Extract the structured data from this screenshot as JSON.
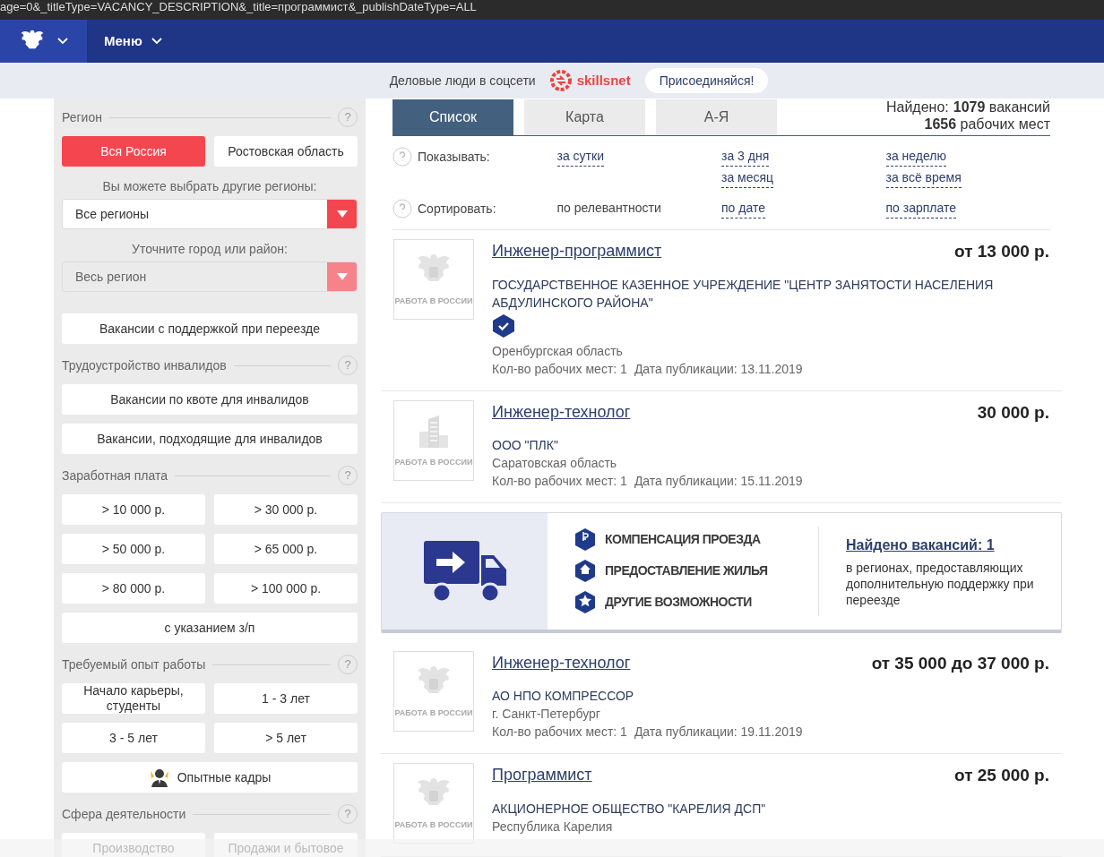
{
  "address_bar": {
    "url": "age=0&_titleType=VACANCY_DESCRIPTION&_title=программист&_publishDateType=ALL"
  },
  "nav": {
    "menu_label": "Меню"
  },
  "banner": {
    "text": "Деловые люди в соцсети",
    "brand": "skillsnet",
    "join_button": "Присоединяйся!"
  },
  "sidebar": {
    "sections": [
      {
        "title": "Регион",
        "help": "?",
        "items": [
          {
            "kind": "half",
            "label": "Вся Россия",
            "selected": true
          },
          {
            "kind": "half",
            "label": "Ростовская область",
            "selected": false
          },
          {
            "kind": "caption",
            "label": "Вы можете выбрать другие регионы:"
          },
          {
            "kind": "select",
            "label": "Все регионы",
            "disabled": false
          },
          {
            "kind": "caption",
            "label": "Уточните город или район:"
          },
          {
            "kind": "select",
            "label": "Весь регион",
            "disabled": true
          },
          {
            "kind": "gap"
          },
          {
            "kind": "wide",
            "label": "Вакансии с поддержкой при переезде",
            "selected": false
          }
        ]
      },
      {
        "title": "Трудоустройство инвалидов",
        "help": "?",
        "items": [
          {
            "kind": "wide",
            "label": "Вакансии по квоте для инвалидов",
            "selected": false
          },
          {
            "kind": "wide",
            "label": "Вакансии, подходящие для инвалидов",
            "selected": false
          }
        ]
      },
      {
        "title": "Заработная плата",
        "help": "?",
        "items": [
          {
            "kind": "half",
            "label": "> 10 000 р.",
            "selected": false
          },
          {
            "kind": "half",
            "label": "> 30 000 р.",
            "selected": false
          },
          {
            "kind": "half",
            "label": "> 50 000 р.",
            "selected": false
          },
          {
            "kind": "half",
            "label": "> 65 000 р.",
            "selected": false
          },
          {
            "kind": "half",
            "label": "> 80 000 р.",
            "selected": false
          },
          {
            "kind": "half",
            "label": "> 100 000 р.",
            "selected": false
          },
          {
            "kind": "wide",
            "label": "с указанием з/п",
            "selected": false
          }
        ]
      },
      {
        "title": "Требуемый опыт работы",
        "help": "?",
        "items": [
          {
            "kind": "half",
            "label": "Начало карьеры, студенты",
            "selected": false
          },
          {
            "kind": "half",
            "label": "1 - 3 лет",
            "selected": false
          },
          {
            "kind": "half",
            "label": "3 - 5 лет",
            "selected": false
          },
          {
            "kind": "half",
            "label": "> 5 лет",
            "selected": false
          },
          {
            "kind": "icon",
            "label": "Опытные кадры",
            "selected": false
          }
        ]
      },
      {
        "title": "Сфера деятельности",
        "help": "?",
        "items": [
          {
            "kind": "half",
            "label": "Производство",
            "selected": false
          },
          {
            "kind": "half",
            "label": "Продажи и бытовое",
            "selected": false
          }
        ]
      }
    ]
  },
  "tabs": [
    {
      "label": "Список",
      "selected": true
    },
    {
      "label": "Карта",
      "selected": false
    },
    {
      "label": "А-Я",
      "selected": false
    }
  ],
  "found": {
    "label": "Найдено:",
    "vacancies_count": "1079",
    "vacancies_word": "вакансий",
    "places_count": "1656",
    "places_word": "рабочих мест"
  },
  "filters": [
    {
      "label": "Показывать:",
      "columns": [
        [
          {
            "label": "за сутки",
            "selected": false
          }
        ],
        [
          {
            "label": "за 3 дня",
            "selected": false
          },
          {
            "label": "за месяц",
            "selected": false
          }
        ],
        [
          {
            "label": "за неделю",
            "selected": false
          },
          {
            "label": "за всё время",
            "selected": false
          }
        ]
      ]
    },
    {
      "label": "Сортировать:",
      "columns": [
        [
          {
            "label": "по релевантности",
            "selected": true
          }
        ],
        [
          {
            "label": "по дате",
            "selected": false
          }
        ],
        [
          {
            "label": "по зарплате",
            "selected": false
          }
        ]
      ]
    }
  ],
  "results": [
    {
      "kind": "vacancy",
      "logo": {
        "kind": "emblem",
        "caption": "РАБОТА В РОССИИ"
      },
      "title": "Инженер-программист",
      "salary": "от 13 000 р.",
      "company": "ГОСУДАРСТВЕННОЕ КАЗЕННОЕ УЧРЕЖДЕНИЕ \"ЦЕНТР ЗАНЯТОСТИ НАСЕЛЕНИЯ АБДУЛИНСКОГО РАЙОНА\"",
      "verified": true,
      "region": "Оренбургская область",
      "places": "Кол-во рабочих мест: 1",
      "date": "Дата публикации: 13.11.2019"
    },
    {
      "kind": "vacancy",
      "logo": {
        "kind": "building",
        "caption": "РАБОТА В РОССИИ"
      },
      "title": "Инженер-технолог",
      "salary": "30 000 р.",
      "company": "ООО \"ПЛК\"",
      "verified": false,
      "region": "Саратовская область",
      "places": "Кол-во рабочих мест: 1",
      "date": "Дата публикации: 15.11.2019"
    },
    {
      "kind": "promo",
      "features": [
        {
          "label": "КОМПЕНСАЦИЯ ПРОЕЗДА"
        },
        {
          "label": "ПРЕДОСТАВЛЕНИЕ ЖИЛЬЯ"
        },
        {
          "label": "ДРУГИЕ ВОЗМОЖНОСТИ"
        }
      ],
      "link": "Найдено вакансий: 1",
      "text": "в регионах, предоставляющих дополнительную поддержку при переезде"
    },
    {
      "kind": "vacancy",
      "logo": {
        "kind": "emblem",
        "caption": "РАБОТА В РОССИИ"
      },
      "title": "Инженер-технолог",
      "salary": "от 35 000 до 37 000 р.",
      "company": "АО НПО КОМПРЕССОР",
      "verified": false,
      "region": "г. Санкт-Петербург",
      "places": "Кол-во рабочих мест: 1",
      "date": "Дата публикации: 19.11.2019"
    },
    {
      "kind": "vacancy",
      "logo": {
        "kind": "emblem",
        "caption": "РАБОТА В РОССИИ"
      },
      "title": "Программист",
      "salary": "от 25 000 р.",
      "company": "АКЦИОНЕРНОЕ ОБЩЕСТВО \"КАРЕЛИЯ ДСП\"",
      "verified": false,
      "region": "Республика Карелия"
    }
  ]
}
